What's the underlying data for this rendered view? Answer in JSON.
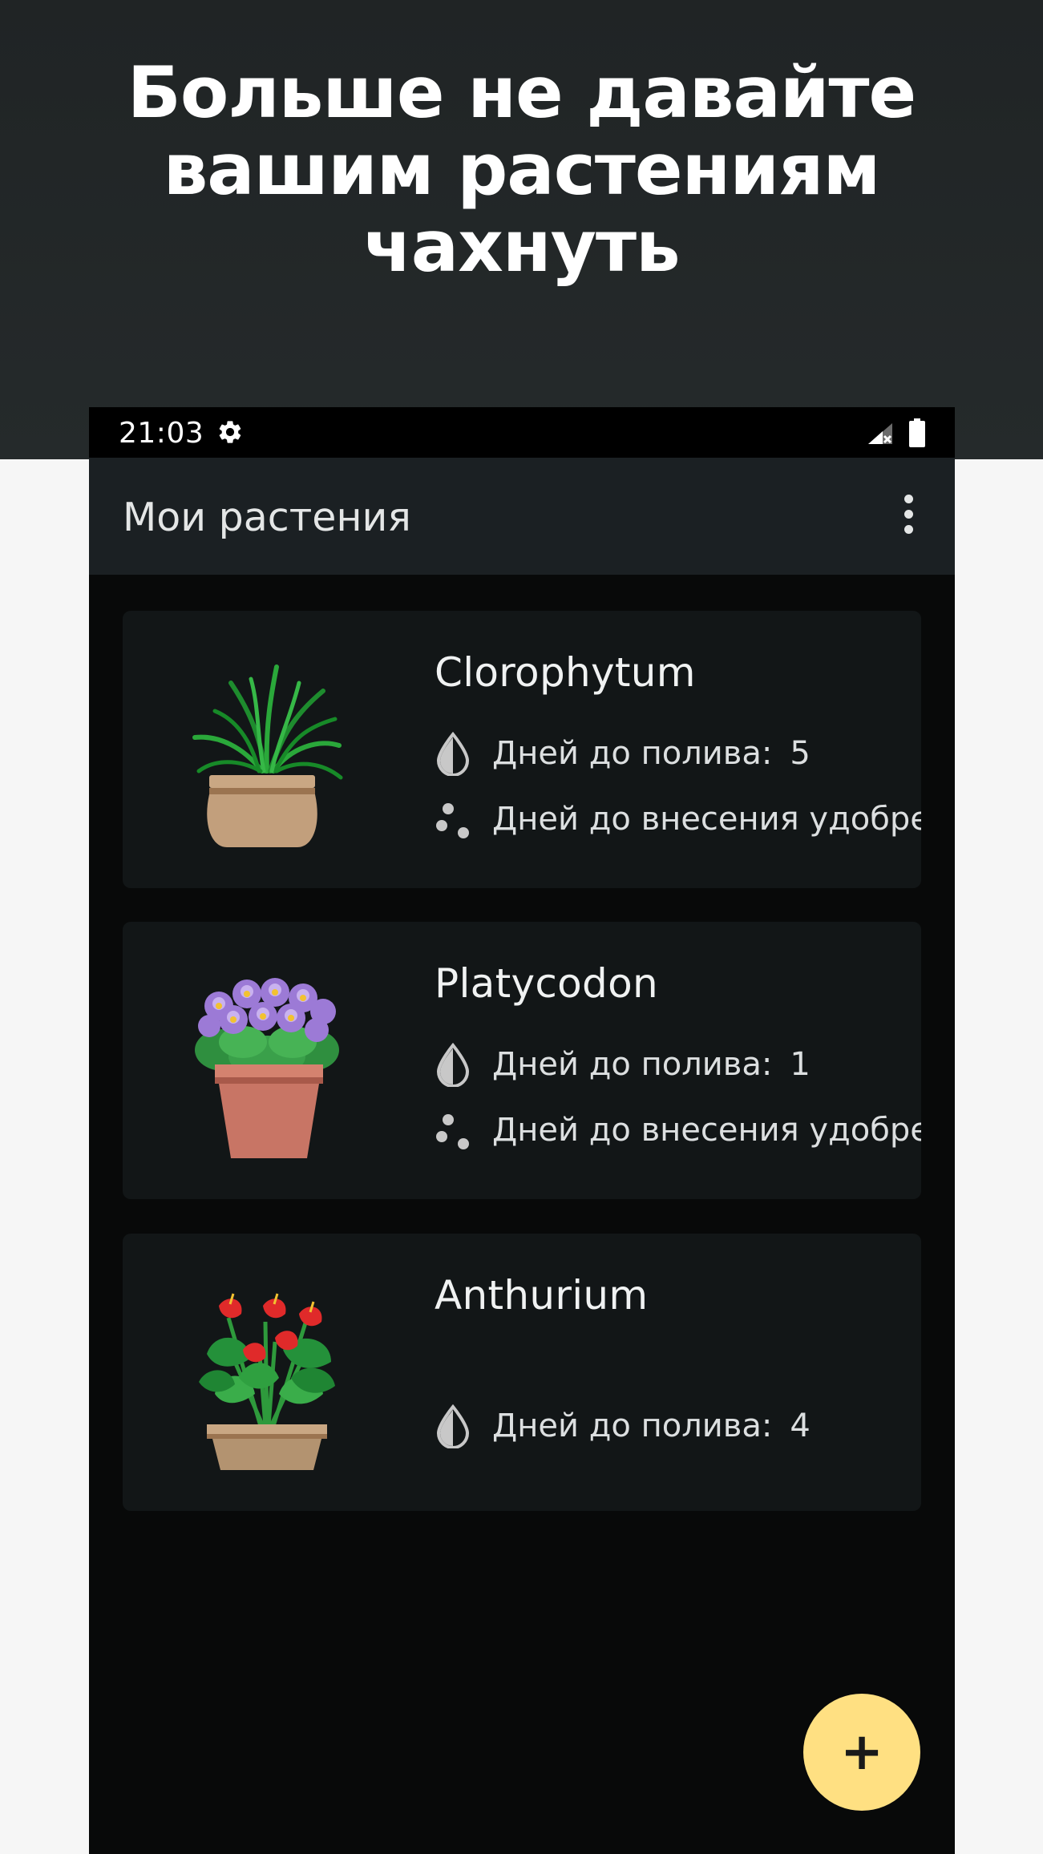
{
  "promo": {
    "headline_line1": "Больше не давайте",
    "headline_line2": "вашим растениям чахнуть"
  },
  "status_bar": {
    "time": "21:03",
    "icons": [
      "gear-icon",
      "signal-icon",
      "battery-icon"
    ]
  },
  "app_bar": {
    "title": "Мои растения",
    "menu_icon": "more-vert-icon"
  },
  "plants": [
    {
      "name": "Clorophytum",
      "watering_label": "Дней до полива:",
      "watering_days": "5",
      "fertilizer_label": "Дней до внесения удобрений:"
    },
    {
      "name": "Platycodon",
      "watering_label": "Дней до полива:",
      "watering_days": "1",
      "fertilizer_label": "Дней до внесения удобрений:"
    },
    {
      "name": "Anthurium",
      "watering_label": "Дней до полива:",
      "watering_days": "4"
    }
  ],
  "fab": {
    "label": "+",
    "color": "#ffe082"
  },
  "colors": {
    "background": "#080909",
    "card": "#121617",
    "app_bar": "#1b2023"
  }
}
